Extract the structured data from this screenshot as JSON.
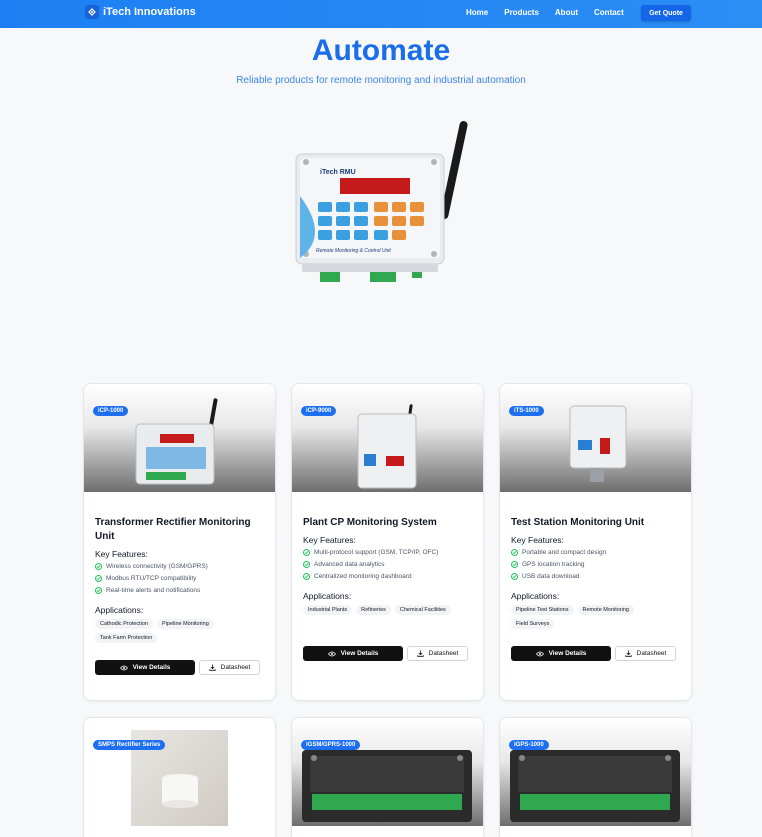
{
  "brand": {
    "name": "iTech Innovations"
  },
  "nav": {
    "links": [
      "Home",
      "Products",
      "About",
      "Contact"
    ],
    "cta": "Get Quote"
  },
  "hero": {
    "title": "Automate",
    "subtitle": "Reliable products for remote monitoring and industrial automation"
  },
  "labels": {
    "features": "Key Features:",
    "applications": "Applications:",
    "view_details": "View Details",
    "datasheet": "Datasheet"
  },
  "products": [
    {
      "badge": "iCP-1000",
      "title": "Transformer Rectifier Monitoring Unit",
      "features": [
        "Wireless connectivity (GSM/GPRS)",
        "Modbus RTU/TCP compatibility",
        "Real-time alerts and notifications"
      ],
      "applications": [
        "Cathodic Protection",
        "Pipeline Monitoring",
        "Tank Farm Protection"
      ]
    },
    {
      "badge": "iCP-9000",
      "title": "Plant CP Monitoring System",
      "features": [
        "Multi-protocol support (GSM, TCP/IP, OFC)",
        "Advanced data analytics",
        "Centralized monitoring dashboard"
      ],
      "applications": [
        "Industrial Plants",
        "Refineries",
        "Chemical Facilities"
      ]
    },
    {
      "badge": "iTS-1000",
      "title": "Test Station Monitoring Unit",
      "features": [
        "Portable and compact design",
        "GPS location tracking",
        "USB data download"
      ],
      "applications": [
        "Pipeline Test Stations",
        "Remote Monitoring",
        "Field Surveys"
      ]
    },
    {
      "badge": "SMPS Rectifier Series"
    },
    {
      "badge": "iGSM/GPRS-1000"
    },
    {
      "badge": "iGPS-1000"
    }
  ],
  "colors": {
    "primary": "#1d7ff3",
    "accent": "#1a6ee8",
    "check": "#22c55e"
  }
}
